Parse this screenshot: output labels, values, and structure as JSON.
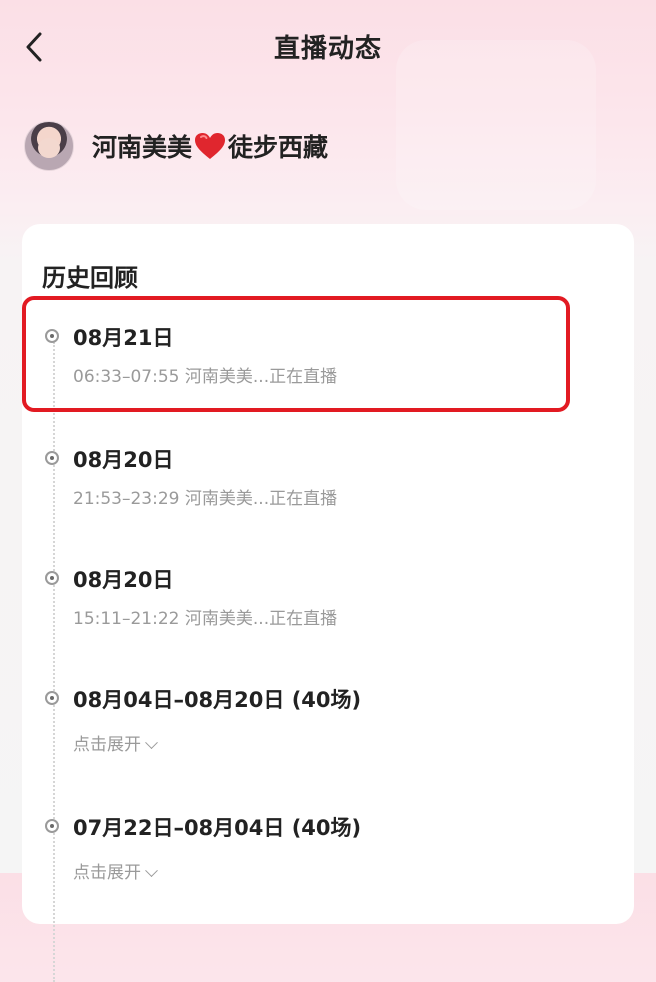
{
  "header": {
    "title": "直播动态"
  },
  "anchor": {
    "name_part1": "河南美美",
    "name_part2": "徒步西藏"
  },
  "history": {
    "title": "历史回顾",
    "entries": [
      {
        "date": "08月21日",
        "detail": "06:33–07:55 河南美美...正在直播"
      },
      {
        "date": "08月20日",
        "detail": "21:53–23:29 河南美美...正在直播"
      },
      {
        "date": "08月20日",
        "detail": "15:11–21:22 河南美美...正在直播"
      },
      {
        "date": "08月04日–08月20日 (40场)",
        "expand": "点击展开"
      },
      {
        "date": "07月22日–08月04日 (40场)",
        "expand": "点击展开"
      }
    ]
  },
  "colors": {
    "highlight": "#e21a22",
    "muted_text": "#9a9a9a"
  }
}
